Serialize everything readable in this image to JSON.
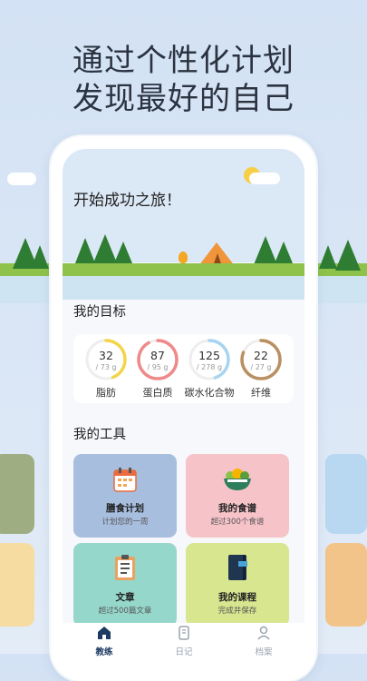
{
  "headline": {
    "line1": "通过个性化计划",
    "line2": "发现最好的自己"
  },
  "screen": {
    "greeting": "开始成功之旅！"
  },
  "goals": {
    "title": "我的目标",
    "items": [
      {
        "value": "32",
        "target": "/ 73 g",
        "label": "脂肪",
        "color": "#f3d54a",
        "progress": 0.44
      },
      {
        "value": "87",
        "target": "/ 95 g",
        "label": "蛋白质",
        "color": "#ef8a8a",
        "progress": 0.92
      },
      {
        "value": "125",
        "target": "/ 278 g",
        "label": "碳水化合物",
        "color": "#a9d4ef",
        "progress": 0.45
      },
      {
        "value": "22",
        "target": "/ 27 g",
        "label": "纤维",
        "color": "#b99062",
        "progress": 0.81
      }
    ]
  },
  "tools": {
    "title": "我的工具",
    "items": [
      {
        "title": "膳食计划",
        "subtitle": "计划您的一周",
        "bg": "#a8bedf",
        "icon": "calendar-icon"
      },
      {
        "title": "我的食谱",
        "subtitle": "超过300个食谱",
        "bg": "#f6c3c9",
        "icon": "salad-bowl-icon"
      },
      {
        "title": "文章",
        "subtitle": "超过500篇文章",
        "bg": "#96d7cc",
        "icon": "clipboard-icon"
      },
      {
        "title": "我的课程",
        "subtitle": "完成并保存",
        "bg": "#d7e68f",
        "icon": "notebook-icon"
      }
    ]
  },
  "tabs": [
    {
      "label": "教练",
      "icon": "home-icon",
      "active": true
    },
    {
      "label": "日记",
      "icon": "diary-icon",
      "active": false
    },
    {
      "label": "档案",
      "icon": "profile-icon",
      "active": false
    }
  ],
  "colors": {
    "accent": "#1d3a63",
    "inactive": "#9aa3b0"
  }
}
